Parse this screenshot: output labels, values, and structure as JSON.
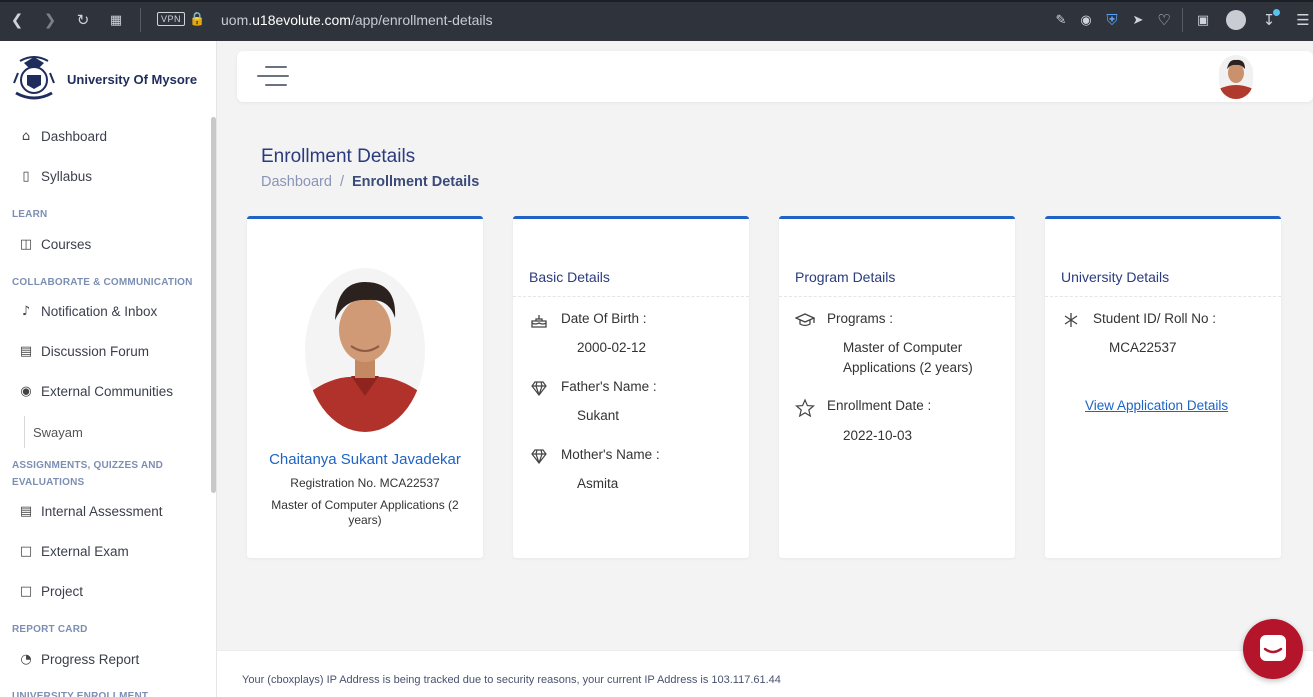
{
  "browser": {
    "url_prefix": "uom.",
    "url_domain": "u18evolute.com",
    "url_path": "/app/enrollment-details",
    "vpn_label": "VPN"
  },
  "sidebar": {
    "brand": "University Of Mysore",
    "items": [
      {
        "label": "Dashboard",
        "icon": "home-icon"
      },
      {
        "label": "Syllabus",
        "icon": "book-icon"
      },
      {
        "label": "Courses",
        "icon": "open-book-icon"
      },
      {
        "label": "Notification & Inbox",
        "icon": "bell-icon"
      },
      {
        "label": "Discussion Forum",
        "icon": "forum-icon"
      },
      {
        "label": "External Communities",
        "icon": "globe-icon"
      },
      {
        "label": "Internal Assessment",
        "icon": "document-icon"
      },
      {
        "label": "External Exam",
        "icon": "file-icon"
      },
      {
        "label": "Project",
        "icon": "file-icon"
      },
      {
        "label": "Progress Report",
        "icon": "chart-pie-icon"
      }
    ],
    "sub_item": "Swayam",
    "headings": {
      "learn": "LEARN",
      "collab": "COLLABORATE & COMMUNICATION",
      "assign": "ASSIGNMENTS, QUIZZES AND EVALUATIONS",
      "report": "REPORT CARD",
      "enroll": "UNIVERSITY ENROLLMENT"
    }
  },
  "page": {
    "title": "Enrollment Details",
    "breadcrumb": {
      "home": "Dashboard",
      "sep": "/",
      "current": "Enrollment Details"
    }
  },
  "profile": {
    "name": "Chaitanya Sukant Javadekar",
    "registration": "Registration No. MCA22537",
    "program": "Master of Computer Applications (2 years)"
  },
  "basic": {
    "title": "Basic Details",
    "dob_label": "Date Of Birth :",
    "dob": "2000-02-12",
    "father_label": "Father's Name :",
    "father": "Sukant",
    "mother_label": "Mother's Name :",
    "mother": "Asmita"
  },
  "program": {
    "title": "Program Details",
    "programs_label": "Programs :",
    "programs": "Master of Computer Applications (2 years)",
    "enroll_label": "Enrollment Date :",
    "enroll_date": "2022-10-03"
  },
  "university": {
    "title": "University Details",
    "id_label": "Student ID/ Roll No :",
    "id": "MCA22537",
    "link": "View Application Details"
  },
  "footer": {
    "text": "Your (cboxplays) IP Address is being tracked due to security reasons, your current IP Address is 103.117.61.44"
  },
  "colors": {
    "accent": "#1e63c5",
    "title": "#2b3b7d",
    "chat": "#b5152b"
  }
}
